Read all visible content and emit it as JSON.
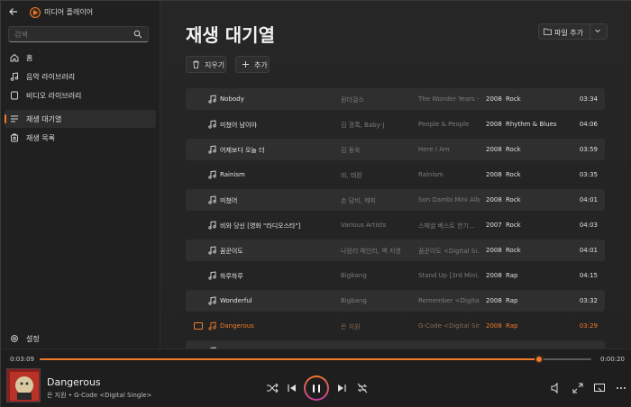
{
  "app": {
    "title": "미디어 플레이어",
    "accent": "#f07a2a"
  },
  "sidebar": {
    "search_placeholder": "검색",
    "items": [
      {
        "label": "홈",
        "icon": "home-icon"
      },
      {
        "label": "음악 라이브러리",
        "icon": "music-note-icon"
      },
      {
        "label": "비디오 라이브러리",
        "icon": "video-icon"
      },
      {
        "label": "재생 대기열",
        "icon": "queue-icon",
        "active": true
      },
      {
        "label": "재생 목록",
        "icon": "playlist-icon"
      }
    ],
    "settings_label": "설정"
  },
  "main": {
    "title": "재생 대기열",
    "add_file_label": "파일 추가",
    "clear_label": "지우기",
    "add_label": "추가"
  },
  "tracks": [
    {
      "title": "Nobody",
      "artist": "원더걸스",
      "album": "The Wonder Years -...",
      "year": "2008",
      "genre": "Rock",
      "duration": "03:34"
    },
    {
      "title": "미쳤어 남이야",
      "artist": "김 경록, Baby-J",
      "album": "People & People",
      "year": "2008",
      "genre": "Rhythm & Blues",
      "duration": "04:06"
    },
    {
      "title": "어제보다 오늘 더",
      "artist": "김 동욱",
      "album": "Here I Am",
      "year": "2008",
      "genre": "Rock",
      "duration": "03:59"
    },
    {
      "title": "Rainism",
      "artist": "비, 태완",
      "album": "Rainism",
      "year": "2008",
      "genre": "Rock",
      "duration": "03:35"
    },
    {
      "title": "미쳤어",
      "artist": "손 담비, 제피",
      "album": "Son Dambi Mini Album...",
      "year": "2008",
      "genre": "Rock",
      "duration": "04:01"
    },
    {
      "title": "비와 당신 [영화 \"라디오스타\"]",
      "artist": "Various Artists",
      "album": "스페셜 베스트 한기...",
      "year": "2007",
      "genre": "Rock",
      "duration": "04:03"
    },
    {
      "title": "꿈꾼이도",
      "artist": "나원리 페인리, 백 지영",
      "album": "꿈꾼이도 <Digital Si...",
      "year": "2008",
      "genre": "Rock",
      "duration": "04:01"
    },
    {
      "title": "하루하루",
      "artist": "Bigbang",
      "album": "Stand Up [3rd Mini...",
      "year": "2008",
      "genre": "Rap",
      "duration": "04:15"
    },
    {
      "title": "Wonderful",
      "artist": "Bigbang",
      "album": "Remember <Digital...",
      "year": "2008",
      "genre": "Rap",
      "duration": "03:32"
    },
    {
      "title": "Dangerous",
      "artist": "은 지원",
      "album": "G-Code <Digital Sin...",
      "year": "2008",
      "genre": "Rap",
      "duration": "03:29",
      "playing": true
    },
    {
      "title": "",
      "artist": "",
      "album": "",
      "year": "",
      "genre": "",
      "duration": ""
    }
  ],
  "player": {
    "elapsed": "0:03:09",
    "total": "0:00:20",
    "progress": 0.905,
    "now_playing_title": "Dangerous",
    "now_playing_sub": "은 지원 • G-Code <Digital Single>"
  }
}
